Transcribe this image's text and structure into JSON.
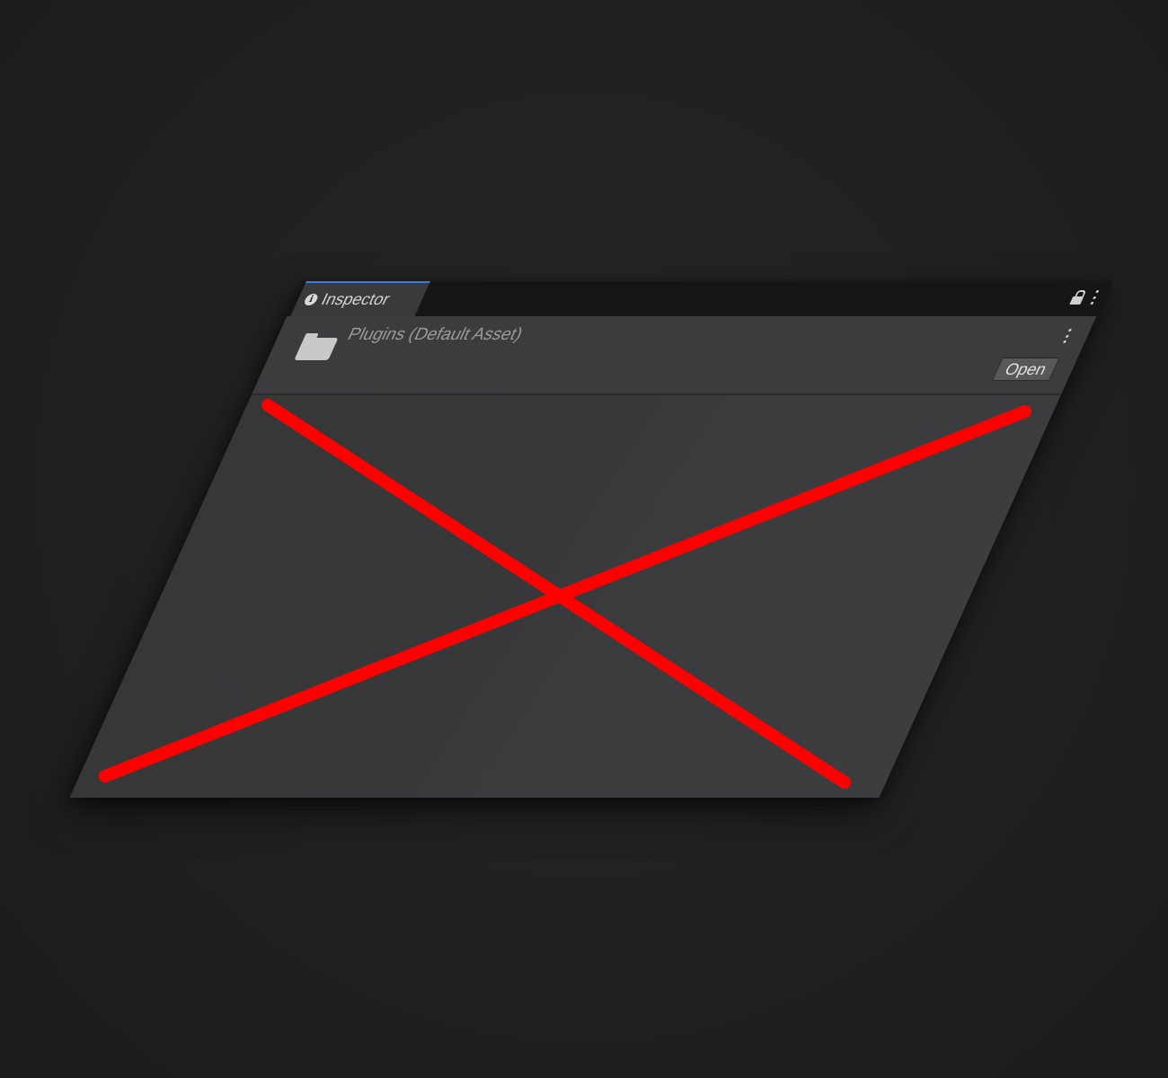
{
  "inspector": {
    "tab_label": "Inspector",
    "tab_icon": "info-icon",
    "accent_color": "#3d7bd8",
    "controls": [
      "lock-icon",
      "kebab-menu-icon"
    ]
  },
  "asset_header": {
    "icon": "folder-icon",
    "title": "Plugins (Default Asset)",
    "menu_icon": "kebab-menu-icon",
    "open_button_label": "Open"
  },
  "overlay": {
    "type": "cross-out",
    "color": "#ff0000"
  }
}
